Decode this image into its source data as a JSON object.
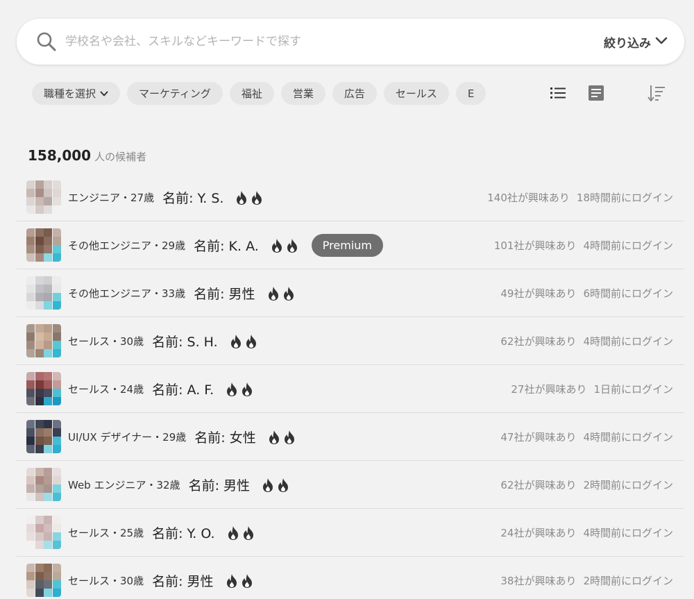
{
  "search": {
    "placeholder": "学校名や会社、スキルなどキーワードで探す",
    "filter_label": "絞り込み"
  },
  "filters": {
    "job_select": "職種を選択",
    "chips": [
      "マーケティング",
      "福祉",
      "営業",
      "広告",
      "セールス",
      "E"
    ]
  },
  "view_icons": [
    "list-view-icon",
    "card-view-icon",
    "sort-icon"
  ],
  "summary": {
    "count": "158,000",
    "label": "人の候補者"
  },
  "candidates": [
    {
      "job": "エンジニア・27歳",
      "name": "名前: Y. S.",
      "premium": "",
      "interest": "140社が興味あり",
      "login": "18時間前にログイン",
      "avatar": [
        "#d9d2ce",
        "#b7a49d",
        "#d7cfcc",
        "#e2dcdb",
        "#c8b9b4",
        "#a78f88",
        "#cfc4c2",
        "#ded7d6",
        "#dcd5d3",
        "#c9bab6",
        "#b9a9a5",
        "#e4dedd",
        "#e9e6e6",
        "#d4cac8",
        "#e2dcdb",
        "#f2f2f2"
      ]
    },
    {
      "job": "その他エンジニア・29歳",
      "name": "名前: K. A.",
      "premium": "Premium",
      "interest": "101社が興味あり",
      "login": "4時間前にログイン",
      "avatar": [
        "#b59d91",
        "#8c6e5f",
        "#7a5c4d",
        "#c4b2a9",
        "#9c7e70",
        "#6b4c3e",
        "#8a6b5c",
        "#b8a398",
        "#a98f82",
        "#7d5f51",
        "#96786a",
        "#5fc9d6",
        "#cdbfb8",
        "#a48b7e",
        "#8fd8e2",
        "#3bb8d0"
      ]
    },
    {
      "job": "その他エンジニア・33歳",
      "name": "名前: 男性",
      "premium": "",
      "interest": "49社が興味あり",
      "login": "6時間前にログイン",
      "avatar": [
        "#ececec",
        "#d6d6d8",
        "#cfcfd2",
        "#ececec",
        "#e4e4e6",
        "#c2c2c6",
        "#b8b8bd",
        "#e8e8ea",
        "#d8d8da",
        "#b0b0b6",
        "#a9a9b0",
        "#6fd0dc",
        "#ececec",
        "#dcdcde",
        "#7fd6e0",
        "#34b5cf"
      ]
    },
    {
      "job": "セールス・30歳",
      "name": "名前: S. H.",
      "premium": "",
      "interest": "62社が興味あり",
      "login": "4時間前にログイン",
      "avatar": [
        "#a8988c",
        "#c2aa96",
        "#b89e8a",
        "#9c8a7e",
        "#8e7a6c",
        "#d4bba6",
        "#caa992",
        "#88766a",
        "#a08c7e",
        "#cdb3a0",
        "#b99a86",
        "#57c6d5",
        "#b2a296",
        "#9a8677",
        "#7fd3de",
        "#36b6cf"
      ]
    },
    {
      "job": "セールス・24歳",
      "name": "名前: A. F.",
      "premium": "",
      "interest": "27社が興味あり",
      "login": "1日前にログイン",
      "avatar": [
        "#c7a7a7",
        "#a86a6a",
        "#b57575",
        "#d3b7b7",
        "#9a5a5a",
        "#7a3a3a",
        "#a05858",
        "#c29a9a",
        "#50505f",
        "#3a3a4a",
        "#4a4a5c",
        "#4bc2d4",
        "#6d6d7a",
        "#2e2e3c",
        "#2aa9cc",
        "#1c99c3"
      ]
    },
    {
      "job": "UI/UX デザイナー・29歳",
      "name": "名前: 女性",
      "premium": "",
      "interest": "47社が興味あり",
      "login": "4時間前にログイン",
      "avatar": [
        "#6a7080",
        "#3e4456",
        "#2e3446",
        "#6c7282",
        "#4a5062",
        "#8a6e5e",
        "#9a7b68",
        "#3a4052",
        "#2a3042",
        "#6e5446",
        "#7e6050",
        "#46bcd2",
        "#5a6070",
        "#3a3e4e",
        "#7fd3de",
        "#2eaed0"
      ]
    },
    {
      "job": "Web エンジニア・32歳",
      "name": "名前: 男性",
      "premium": "",
      "interest": "62社が興味あり",
      "login": "2時間前にログイン",
      "avatar": [
        "#e3d9d6",
        "#c9b4ae",
        "#b89e97",
        "#e6dfdd",
        "#d8c6c1",
        "#a88a82",
        "#b69a92",
        "#e0d6d3",
        "#c4b2ad",
        "#b3a19b",
        "#a6958f",
        "#79d3df",
        "#eae6e5",
        "#d1c3bf",
        "#9fdde6",
        "#4bbdd4"
      ]
    },
    {
      "job": "セールス・25歳",
      "name": "名前: Y. O.",
      "premium": "",
      "interest": "24社が興味あり",
      "login": "4時間前にログイン",
      "avatar": [
        "#f1eeee",
        "#d9cccc",
        "#c9b3b3",
        "#f0eded",
        "#e5dada",
        "#c7a9a9",
        "#d2bcbc",
        "#eee9e9",
        "#e7dede",
        "#d8c8c8",
        "#c8b4b4",
        "#86d6e0",
        "#f2f2f2",
        "#e2d8d8",
        "#a6dfe8",
        "#59c1d6"
      ]
    },
    {
      "job": "セールス・30歳",
      "name": "名前: 男性",
      "premium": "",
      "interest": "38社が興味あり",
      "login": "2時間前にログイン",
      "avatar": [
        "#c8b8ac",
        "#9e7e6a",
        "#8a6c58",
        "#c2b0a4",
        "#b49886",
        "#7c5e4c",
        "#8e705e",
        "#bca898",
        "#d6cac2",
        "#5a5f6a",
        "#6a6f7a",
        "#4fc4d4",
        "#e0d8d2",
        "#44495a",
        "#7fd3de",
        "#2eaed0"
      ]
    }
  ]
}
